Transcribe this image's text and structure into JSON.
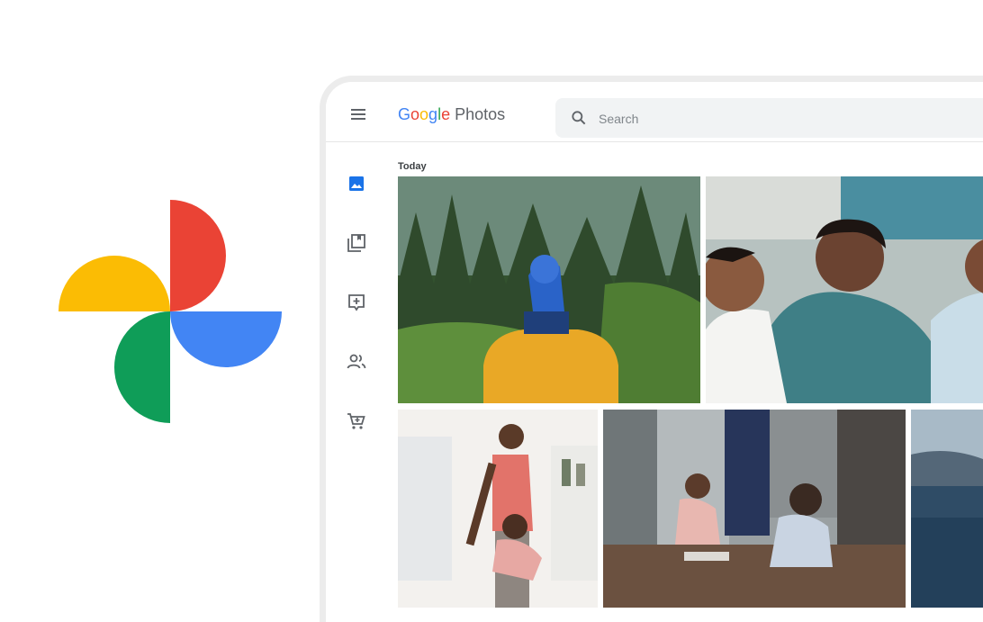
{
  "app": {
    "brand_google": [
      "G",
      "o",
      "o",
      "g",
      "l",
      "e"
    ],
    "brand_product": "Photos"
  },
  "search": {
    "placeholder": "Search"
  },
  "sections": [
    {
      "label": "Today"
    }
  ],
  "sidebar": {
    "items": [
      {
        "icon": "photos-icon",
        "active": true
      },
      {
        "icon": "albums-icon"
      },
      {
        "icon": "add-to-album-icon"
      },
      {
        "icon": "sharing-icon"
      },
      {
        "icon": "print-store-icon"
      }
    ]
  },
  "photos": [
    {
      "subject": "forest-child-on-shoulders"
    },
    {
      "subject": "family-laughing-on-couch"
    },
    {
      "subject": "mother-and-daughter-dancing"
    },
    {
      "subject": "children-on-kitchen-floor"
    },
    {
      "subject": "lake-and-mountains"
    }
  ],
  "colors": {
    "logo_red": "#ea4335",
    "logo_yellow": "#fbbc04",
    "logo_green": "#0f9d58",
    "logo_blue": "#4285f4",
    "active_nav": "#1a73e8"
  }
}
